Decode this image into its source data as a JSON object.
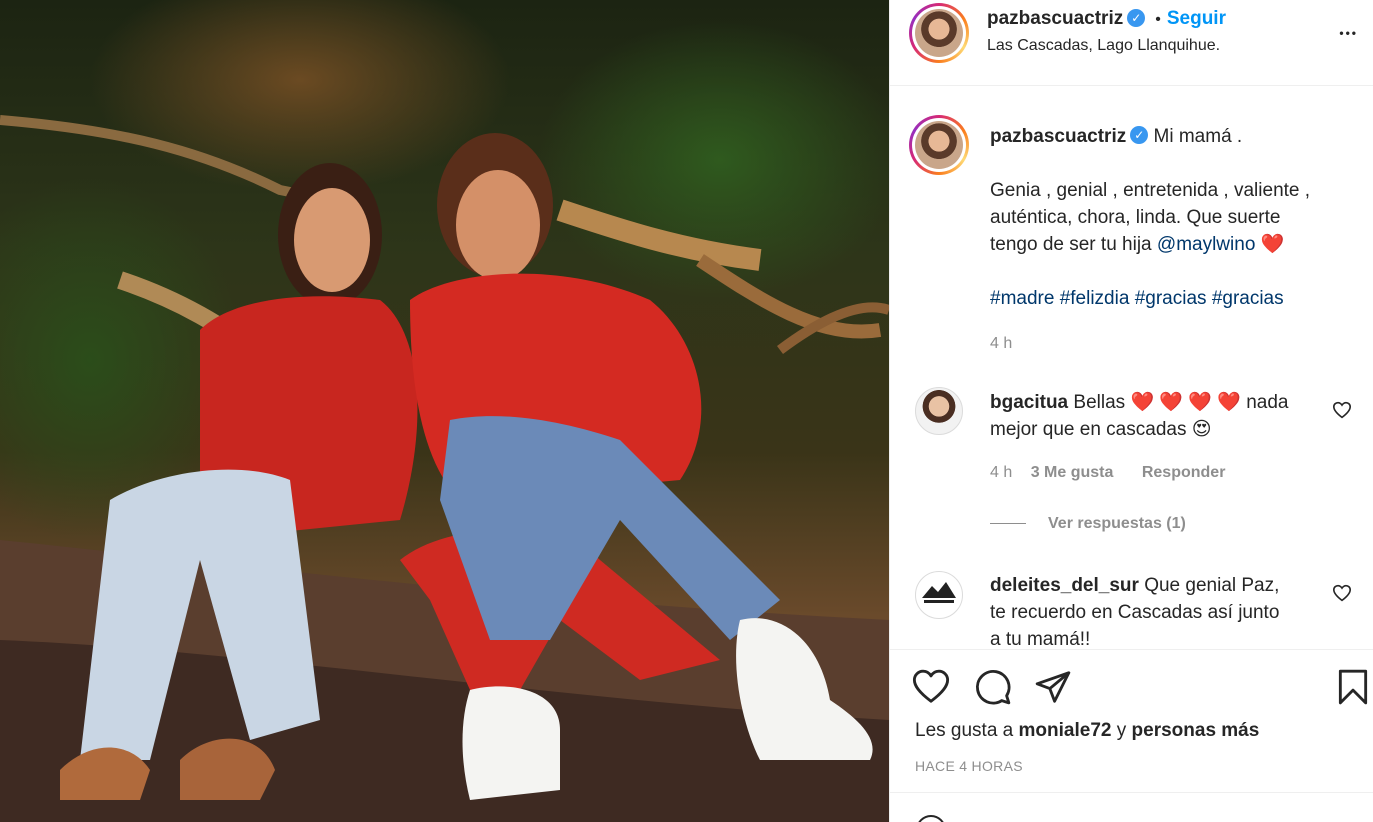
{
  "post": {
    "username": "pazbascuactriz",
    "verified_mark": "✓",
    "separator": "•",
    "follow_label": "Seguir",
    "location": "Las Cascadas, Lago Llanquihue.",
    "more_label": "•••"
  },
  "caption": {
    "username": "pazbascuactriz",
    "first_line": "Mi mamá .",
    "body_1": "Genia , genial , entretenida , valiente ,",
    "body_2": "auténtica, chora, linda. Que suerte",
    "body_3": "tengo de ser tu hija",
    "mention": "@maylwino",
    "heart_emoji": "❤️",
    "hashtags": [
      "#madre",
      "#felizdia",
      "#gracias",
      "#gracias"
    ],
    "time": "4 h"
  },
  "comments": [
    {
      "username": "bgacitua",
      "text_1": "Bellas",
      "hearts": "❤️ ❤️ ❤️ ❤️",
      "text_2": "nada",
      "text_3": "mejor que en cascadas",
      "emoji": "😍",
      "time": "4 h",
      "likes": "3 Me gusta",
      "reply": "Responder",
      "view_replies": "Ver respuestas (1)"
    },
    {
      "username": "deleites_del_sur",
      "text_1": "Que genial Paz,",
      "text_2": "te recuerdo en Cascadas así junto",
      "text_3": "a tu mamá!!"
    }
  ],
  "footer": {
    "likes_prefix": "Les gusta a",
    "likes_user": "moniale72",
    "likes_and": "y",
    "likes_suffix": "personas más",
    "time": "HACE 4 HORAS"
  },
  "colors": {
    "follow_blue": "#0095f6",
    "link_navy": "#00376b",
    "verified_blue": "#3897f0",
    "heart_red": "#ed4956"
  },
  "icons": [
    "verified-icon",
    "more-icon",
    "heart-icon",
    "comment-icon",
    "share-icon",
    "bookmark-icon",
    "like-comment-icon",
    "emoji-icon"
  ]
}
